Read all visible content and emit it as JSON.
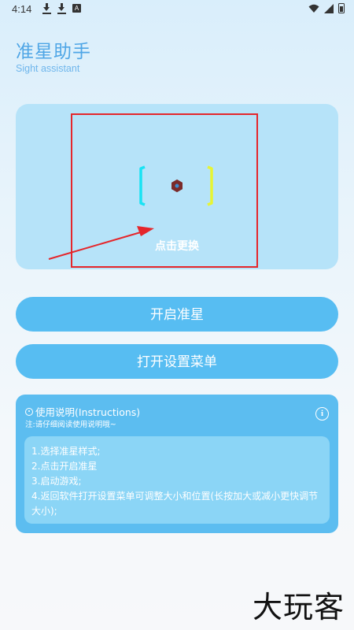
{
  "status_bar": {
    "time": "4:14",
    "box_glyph": "A",
    "icons": [
      "download-icon",
      "download-icon",
      "app-box-icon",
      "wifi-icon",
      "signal-icon",
      "battery-icon"
    ]
  },
  "header": {
    "title": "准星助手",
    "subtitle": "Sight assistant"
  },
  "preview": {
    "tap_label": "点击更换",
    "crosshair_left_color": "#19e3f4",
    "crosshair_right_color": "#e7f533",
    "center_color": "#7a2b2b"
  },
  "annotation": {
    "box_color": "#e5262b",
    "arrow_color": "#e5262b"
  },
  "buttons": {
    "start": "开启准星",
    "settings": "打开设置菜单"
  },
  "instructions": {
    "title": "使用说明(Instructions)",
    "note": "注:请仔细阅读使用说明哦~",
    "items": [
      "1.选择准星样式;",
      "2.点击开启准星",
      "3.启动游戏;",
      "4.返回软件打开设置菜单可调整大小和位置(长按加大或减小更快调节大小);"
    ]
  },
  "watermark": "大玩客",
  "colors": {
    "accent": "#57bdf2",
    "title": "#4fa6e6",
    "card": "#b6e3f9"
  }
}
